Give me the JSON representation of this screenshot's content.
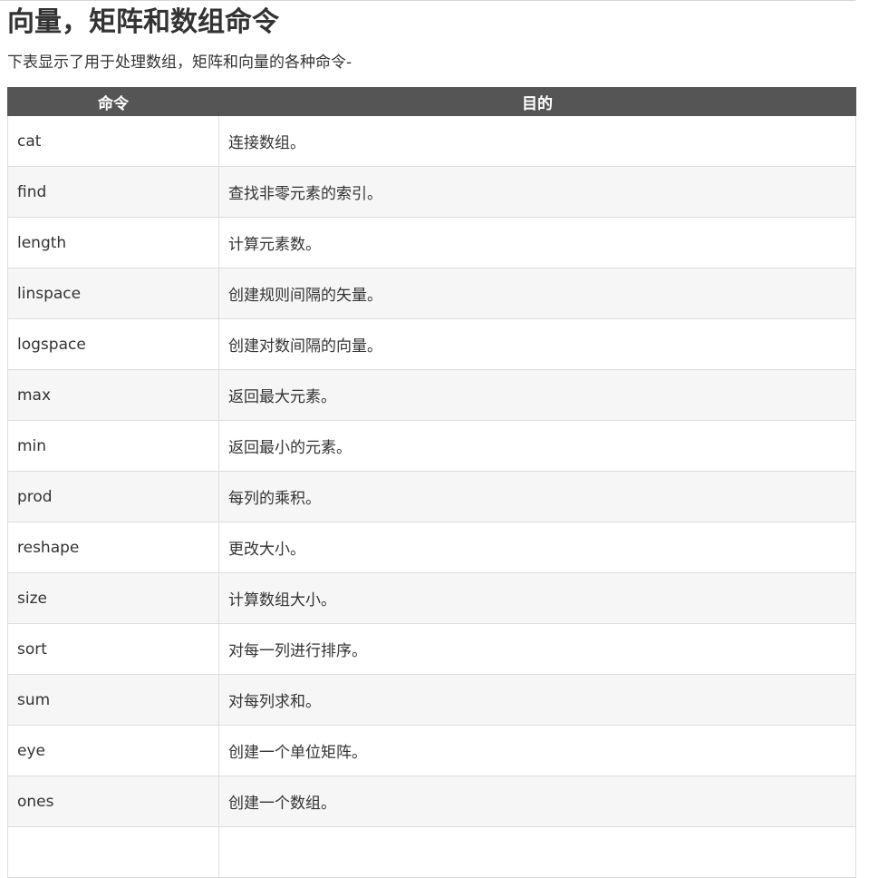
{
  "page": {
    "title": "向量，矩阵和数组命令",
    "intro": "下表显示了用于处理数组，矩阵和向量的各种命令-"
  },
  "table": {
    "headers": [
      "命令",
      "目的"
    ],
    "rows": [
      {
        "command": "cat",
        "purpose": "连接数组。"
      },
      {
        "command": "find",
        "purpose": "查找非零元素的索引。"
      },
      {
        "command": "length",
        "purpose": "计算元素数。"
      },
      {
        "command": "linspace",
        "purpose": "创建规则间隔的矢量。"
      },
      {
        "command": "logspace",
        "purpose": "创建对数间隔的向量。"
      },
      {
        "command": "max",
        "purpose": "返回最大元素。"
      },
      {
        "command": "min",
        "purpose": "返回最小的元素。"
      },
      {
        "command": "prod",
        "purpose": "每列的乘积。"
      },
      {
        "command": "reshape",
        "purpose": "更改大小。"
      },
      {
        "command": "size",
        "purpose": "计算数组大小。"
      },
      {
        "command": "sort",
        "purpose": "对每一列进行排序。"
      },
      {
        "command": "sum",
        "purpose": "对每列求和。"
      },
      {
        "command": "eye",
        "purpose": "创建一个单位矩阵。"
      },
      {
        "command": "ones",
        "purpose": "创建一个数组。"
      },
      {
        "command": "",
        "purpose": ""
      }
    ]
  }
}
